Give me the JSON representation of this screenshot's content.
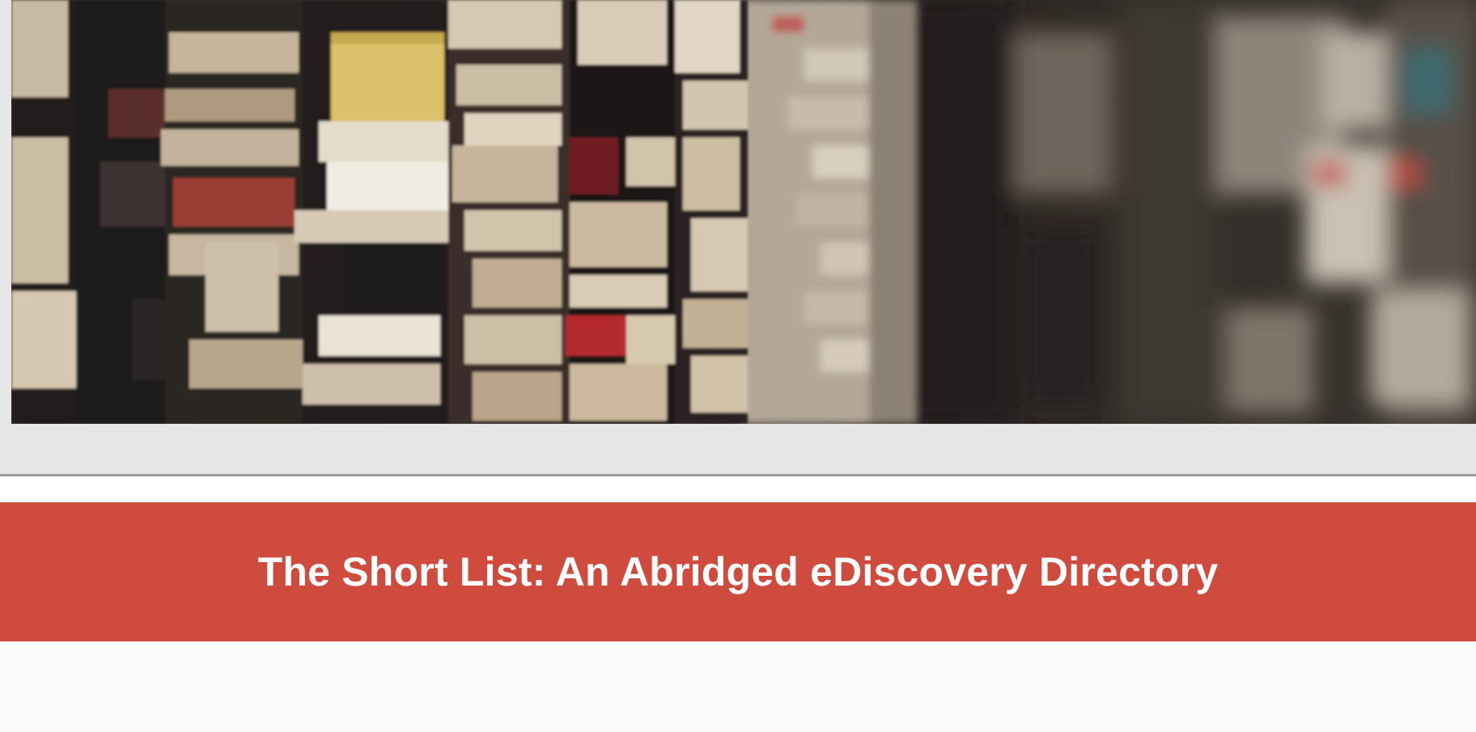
{
  "banner": {
    "title": "The Short List: An Abridged eDiscovery Directory",
    "background_color": "#ce4b3d",
    "text_color": "#ffffff"
  },
  "hero": {
    "image_subject": "books-stacked-photo"
  },
  "colors": {
    "page_background": "#e6e6e6",
    "divider": "#9b9b9b",
    "content_background": "#fbfbfb"
  }
}
